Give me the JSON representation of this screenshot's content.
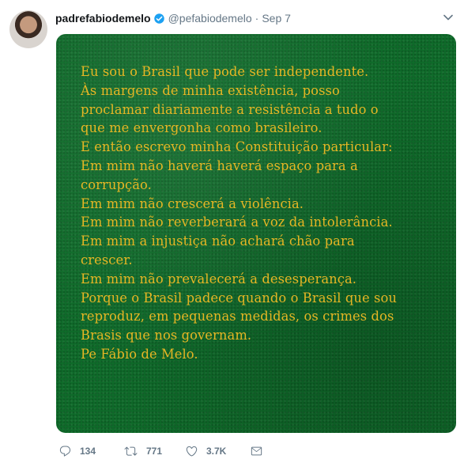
{
  "tweet": {
    "display_name": "padrefabiodemelo",
    "handle": "@pefabiodemelo",
    "separator": "·",
    "date": "Sep 7"
  },
  "poem": {
    "lines": [
      "Eu sou o Brasil que pode ser independente.",
      "Às margens de minha existência, posso",
      "proclamar diariamente a resistência a tudo o",
      "que me envergonha como brasileiro.",
      "E então escrevo minha Constituição particular:",
      "Em mim não haverá haverá espaço para a",
      "corrupção.",
      "Em mim não crescerá a violência.",
      "Em mim não reverberará a voz da intolerância.",
      "Em mim a injustiça não achará chão para",
      "crescer.",
      "Em mim não prevalecerá a desesperança.",
      "Porque o Brasil padece quando o Brasil que sou",
      "reproduz, em pequenas medidas, os crimes dos",
      "Brasis que nos governam.",
      "Pe Fábio de Melo."
    ]
  },
  "actions": {
    "replies": "134",
    "retweets": "771",
    "likes": "3.7K"
  },
  "icons": {
    "verified": "verified-badge-icon",
    "caret": "chevron-down-icon",
    "reply": "reply-icon",
    "retweet": "retweet-icon",
    "like": "heart-icon",
    "dm": "envelope-icon"
  },
  "colors": {
    "verified": "#1da1f2",
    "text_gold": "#e6b624",
    "background_green": "#0f6b2a",
    "muted": "#657786"
  }
}
